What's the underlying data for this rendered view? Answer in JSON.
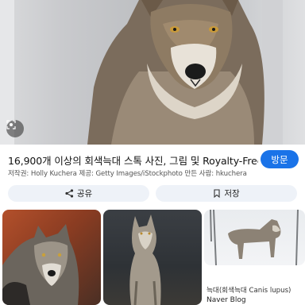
{
  "result": {
    "title": "16,900개 이상의 회색늑대 스톡 사진, 그림 및 Royalty-Free ...",
    "visit_label": "방문",
    "credit": "저작권: Holly Kuchera 제공: Getty Images/iStockphoto 만든 사람: hkuchera"
  },
  "actions": {
    "share_label": "공유",
    "save_label": "저장"
  },
  "related": [
    {
      "caption": ""
    },
    {
      "caption": ""
    },
    {
      "caption": "늑대(회색늑대 Canis lupus)",
      "source": "Naver Blog"
    }
  ],
  "icons": {
    "lens": "lens-icon",
    "share": "share-icon",
    "save": "bookmark-icon"
  },
  "colors": {
    "accent": "#1a73e8",
    "action_bg": "#eef2f8"
  }
}
